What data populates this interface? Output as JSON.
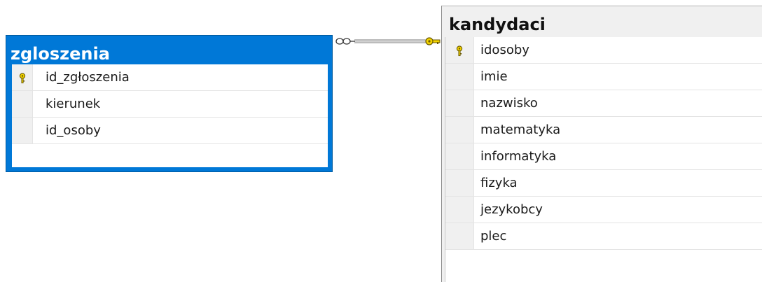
{
  "tables": [
    {
      "id": "zgloszenia",
      "name": "zgloszenia",
      "selected": true,
      "columns": [
        {
          "name": "id_zgłoszenia",
          "primary_key": true
        },
        {
          "name": "kierunek",
          "primary_key": false
        },
        {
          "name": "id_osoby",
          "primary_key": false
        }
      ]
    },
    {
      "id": "kandydaci",
      "name": "kandydaci",
      "selected": false,
      "columns": [
        {
          "name": "idosoby",
          "primary_key": true
        },
        {
          "name": "imie",
          "primary_key": false
        },
        {
          "name": "nazwisko",
          "primary_key": false
        },
        {
          "name": "matematyka",
          "primary_key": false
        },
        {
          "name": "informatyka",
          "primary_key": false
        },
        {
          "name": "fizyka",
          "primary_key": false
        },
        {
          "name": "jezykobcy",
          "primary_key": false
        },
        {
          "name": "plec",
          "primary_key": false
        }
      ]
    }
  ],
  "relationship": {
    "from_table": "zgloszenia",
    "from_end": "many-infinity-icon",
    "to_table": "kandydaci",
    "to_end": "primary-key-icon"
  },
  "colors": {
    "selected_header": "#0078d7",
    "key_icon": "#e0c000",
    "connector": "#808080"
  }
}
